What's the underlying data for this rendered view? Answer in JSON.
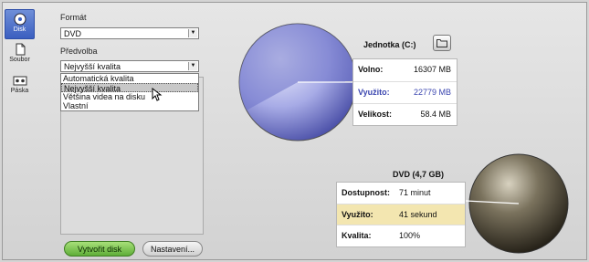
{
  "sidebar": {
    "items": [
      {
        "label": "Disk",
        "icon": "disc-icon",
        "active": true
      },
      {
        "label": "Soubor",
        "icon": "file-icon",
        "active": false
      },
      {
        "label": "Páska",
        "icon": "tape-icon",
        "active": false
      }
    ]
  },
  "format": {
    "label": "Formát",
    "value": "DVD"
  },
  "preset": {
    "label": "Předvolba",
    "value": "Nejvyšší kvalita",
    "options": [
      "Automatická kvalita",
      "Nejvyšší kvalita",
      "Většina videa na disku",
      "Vlastní"
    ],
    "selected_index": 1
  },
  "buttons": {
    "create": "Vytvořit disk",
    "settings": "Nastavení..."
  },
  "drive": {
    "title": "Jednotka (C:)",
    "rows": [
      {
        "key": "Volno:",
        "value": "16307 MB",
        "highlight": false
      },
      {
        "key": "Využito:",
        "value": "22779 MB",
        "highlight": true
      },
      {
        "key": "Velikost:",
        "value": "58.4 MB",
        "highlight": false
      }
    ],
    "used_fraction": 0.58
  },
  "dvd": {
    "title": "DVD (4,7 GB)",
    "rows": [
      {
        "key": "Dostupnost:",
        "value": "71 minut",
        "highlight": false
      },
      {
        "key": "Využito:",
        "value": "41 sekund",
        "highlight": true
      },
      {
        "key": "Kvalita:",
        "value": "100%",
        "highlight": false
      }
    ]
  },
  "colors": {
    "drive_used": "#4c57b8",
    "dvd_highlight": "#f3e6b0",
    "green_button": "#6fbf45"
  }
}
